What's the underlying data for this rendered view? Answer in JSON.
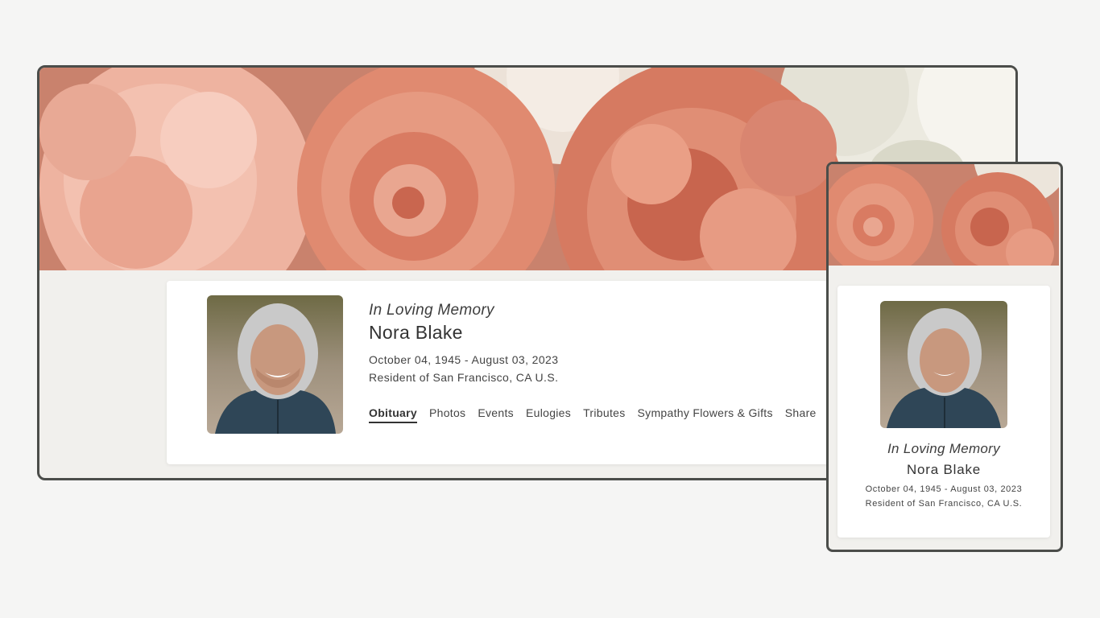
{
  "memorial": {
    "tagline": "In Loving Memory",
    "name": "Nora Blake",
    "dates": "October 04, 1945 - August 03, 2023",
    "resident": "Resident of San Francisco, CA U.S."
  },
  "nav": {
    "items": [
      {
        "label": "Obituary",
        "active": true
      },
      {
        "label": "Photos"
      },
      {
        "label": "Events"
      },
      {
        "label": "Eulogies"
      },
      {
        "label": "Tributes"
      },
      {
        "label": "Sympathy Flowers & Gifts"
      },
      {
        "label": "Share"
      }
    ]
  },
  "colors": {
    "page_bg": "#f5f5f4",
    "frame_border": "#4b4d4a",
    "content_bg": "#f1f0ed",
    "card_bg": "#ffffff",
    "flower_peach": "#e9a68f",
    "flower_coral": "#d9735a",
    "flower_cream": "#f1ece3"
  },
  "icons": [
    "floral-banner-image",
    "portrait-photo"
  ]
}
